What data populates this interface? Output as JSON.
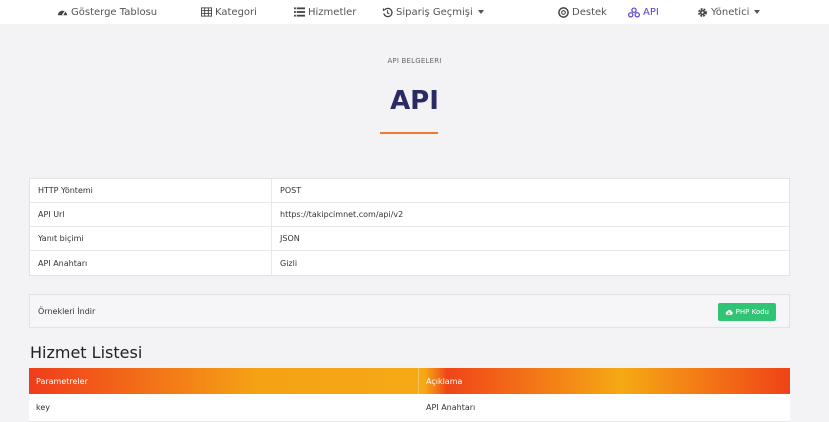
{
  "nav": [
    {
      "label": "Gösterge Tablosu",
      "icon": "dashboard-icon"
    },
    {
      "label": "Kategori",
      "icon": "table-icon"
    },
    {
      "label": "Hizmetler",
      "icon": "list-icon"
    },
    {
      "label": "Sipariş Geçmişi",
      "icon": "history-icon",
      "dropdown": true
    },
    {
      "label": "Destek",
      "icon": "support-icon"
    },
    {
      "label": "API",
      "icon": "api-icon",
      "active": true
    },
    {
      "label": "Yönetici",
      "icon": "gear-icon",
      "dropdown": true
    }
  ],
  "header": {
    "kicker": "API BELGELERI",
    "title": "API"
  },
  "info": [
    {
      "k": "HTTP Yöntemi",
      "v": "POST"
    },
    {
      "k": "API Url",
      "v": "https://takipcimnet.com/api/v2"
    },
    {
      "k": "Yanıt biçimi",
      "v": "JSON"
    },
    {
      "k": "API Anahtarı",
      "v": "Gizli"
    }
  ],
  "download": {
    "label": "Örnekleri İndir",
    "button": "PHP Kodu"
  },
  "services": {
    "title": "Hizmet Listesi",
    "columns": [
      "Parametreler",
      "Açıklama"
    ],
    "rows": [
      {
        "param": "key",
        "desc": "API Anahtarı"
      }
    ]
  },
  "colors": {
    "accent": "#5b3fd1",
    "title": "#2a2a66",
    "underline": "#f17a31",
    "button": "#2fc574"
  }
}
